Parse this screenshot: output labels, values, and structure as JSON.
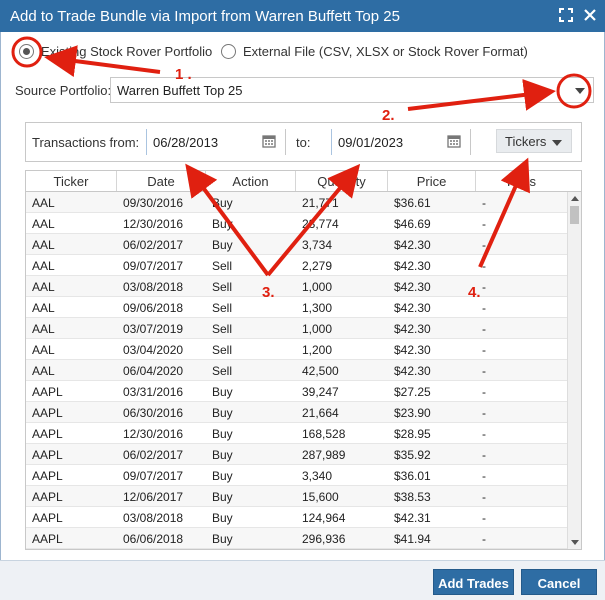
{
  "dialog": {
    "title": "Add to Trade Bundle via Import from Warren Buffett Top 25"
  },
  "source_options": {
    "existing_label": "Existing Stock Rover Portfolio",
    "external_label": "External File (CSV, XLSX or Stock Rover Format)",
    "selected": "existing"
  },
  "source_portfolio": {
    "label": "Source Portfolio:",
    "value": "Warren Buffett Top 25"
  },
  "filter": {
    "from_label": "Transactions from:",
    "from_value": "06/28/2013",
    "to_label": "to:",
    "to_value": "09/01/2023",
    "tickers_label": "Tickers"
  },
  "table": {
    "columns": [
      "Ticker",
      "Date",
      "Action",
      "Quantity",
      "Price",
      "Fees"
    ],
    "rows": [
      [
        "AAL",
        "09/30/2016",
        "Buy",
        "21,771",
        "$36.61",
        "-"
      ],
      [
        "AAL",
        "12/30/2016",
        "Buy",
        "23,774",
        "$46.69",
        "-"
      ],
      [
        "AAL",
        "06/02/2017",
        "Buy",
        "3,734",
        "$42.30",
        "-"
      ],
      [
        "AAL",
        "09/07/2017",
        "Sell",
        "2,279",
        "$42.30",
        "-"
      ],
      [
        "AAL",
        "03/08/2018",
        "Sell",
        "1,000",
        "$42.30",
        "-"
      ],
      [
        "AAL",
        "09/06/2018",
        "Sell",
        "1,300",
        "$42.30",
        "-"
      ],
      [
        "AAL",
        "03/07/2019",
        "Sell",
        "1,000",
        "$42.30",
        "-"
      ],
      [
        "AAL",
        "03/04/2020",
        "Sell",
        "1,200",
        "$42.30",
        "-"
      ],
      [
        "AAL",
        "06/04/2020",
        "Sell",
        "42,500",
        "$42.30",
        "-"
      ],
      [
        "AAPL",
        "03/31/2016",
        "Buy",
        "39,247",
        "$27.25",
        "-"
      ],
      [
        "AAPL",
        "06/30/2016",
        "Buy",
        "21,664",
        "$23.90",
        "-"
      ],
      [
        "AAPL",
        "12/30/2016",
        "Buy",
        "168,528",
        "$28.95",
        "-"
      ],
      [
        "AAPL",
        "06/02/2017",
        "Buy",
        "287,989",
        "$35.92",
        "-"
      ],
      [
        "AAPL",
        "09/07/2017",
        "Buy",
        "3,340",
        "$36.01",
        "-"
      ],
      [
        "AAPL",
        "12/06/2017",
        "Buy",
        "15,600",
        "$38.53",
        "-"
      ],
      [
        "AAPL",
        "03/08/2018",
        "Buy",
        "124,964",
        "$42.31",
        "-"
      ],
      [
        "AAPL",
        "06/06/2018",
        "Buy",
        "296,936",
        "$41.94",
        "-"
      ]
    ]
  },
  "footer": {
    "add_label": "Add Trades",
    "cancel_label": "Cancel"
  },
  "annotations": {
    "n1": "1 .",
    "n2": "2.",
    "n3": "3.",
    "n4": "4."
  },
  "colors": {
    "titlebar": "#2e6da4",
    "annotation": "#e02010",
    "button": "#2e6da4"
  }
}
